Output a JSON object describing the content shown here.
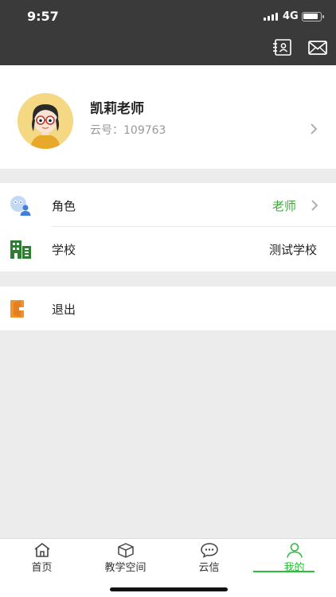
{
  "status_bar": {
    "time": "9:57",
    "network": "4G"
  },
  "nav_bar": {
    "contacts_icon": "contacts-book-icon",
    "mail_icon": "envelope-icon"
  },
  "profile": {
    "name": "凯莉老师",
    "id_text": "云号：109763",
    "avatar_icon": "teacher-avatar-icon"
  },
  "menu": {
    "role": {
      "label": "角色",
      "value": "老师",
      "icon": "role-users-icon",
      "value_color": "#3aaa35"
    },
    "school": {
      "label": "学校",
      "value": "测试学校",
      "icon": "school-building-icon",
      "value_color": "#222222"
    },
    "logout": {
      "label": "退出",
      "icon": "logout-icon"
    }
  },
  "tabs": [
    {
      "label": "首页",
      "icon": "home-icon",
      "active": false
    },
    {
      "label": "教学空间",
      "icon": "cube-icon",
      "active": false
    },
    {
      "label": "云信",
      "icon": "chat-bubble-icon",
      "active": false
    },
    {
      "label": "我的",
      "icon": "person-icon",
      "active": true
    }
  ],
  "colors": {
    "accent": "#2dbd3a",
    "header_bg": "#3a3a3a",
    "page_bg": "#ececec"
  }
}
